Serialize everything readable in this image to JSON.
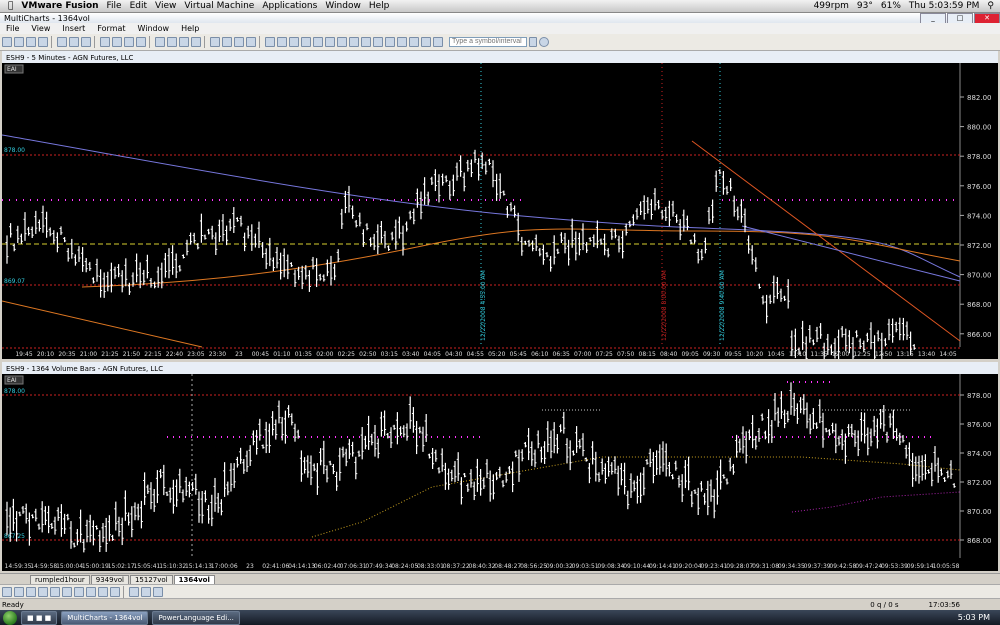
{
  "macmenu": {
    "app": "VMware Fusion",
    "items": [
      "File",
      "Edit",
      "View",
      "Virtual Machine",
      "Applications",
      "Window",
      "Help"
    ],
    "rpm": "499rpm",
    "temp": "93°",
    "battery": "61%",
    "clock": "Thu 5:03:59 PM"
  },
  "window": {
    "title": "MultiCharts - 1364vol"
  },
  "menu": [
    "File",
    "View",
    "Insert",
    "Format",
    "Window",
    "Help"
  ],
  "toolbar": {
    "symbol_placeholder": "Type a symbol/interval"
  },
  "chart1": {
    "header": "ESH9 - 5 Minutes - AGN Futures, LLC",
    "badge": "EAI",
    "level_labels": [
      "878.00",
      "869.07"
    ],
    "price_axis": [
      "882.00",
      "880.00",
      "878.00",
      "876.00",
      "874.00",
      "872.00",
      "870.00",
      "868.00",
      "866.00"
    ],
    "time_axis": [
      "19:45",
      "20:10",
      "20:35",
      "21:00",
      "21:25",
      "21:50",
      "22:15",
      "22:40",
      "23:05",
      "23:30",
      "23",
      "00:45",
      "01:10",
      "01:35",
      "02:00",
      "02:25",
      "02:50",
      "03:15",
      "03:40",
      "04:05",
      "04:30",
      "04:55",
      "05:20",
      "05:45",
      "06:10",
      "06:35",
      "07:00",
      "07:25",
      "07:50",
      "08:15",
      "08:40",
      "09:05",
      "09:30",
      "09:55",
      "10:20",
      "10:45",
      "11:10",
      "11:35",
      "12:00",
      "12:25",
      "12:50",
      "13:15",
      "13:40",
      "14:05"
    ],
    "vline_labels": [
      "12/22/2008 4:55:00 AM",
      "12/22/2008 8:00:00 AM",
      "12/22/2008 9:40:00 AM"
    ]
  },
  "chart2": {
    "header": "ESH9 - 1364 Volume Bars - AGN Futures, LLC",
    "badge": "EAI",
    "level_labels": [
      "878.00",
      "867.25"
    ],
    "price_axis": [
      "878.00",
      "876.00",
      "874.00",
      "872.00",
      "870.00",
      "868.00"
    ],
    "time_axis": [
      "14:59:35",
      "14:59:58",
      "15:00:04",
      "15:00:19",
      "15:02:17",
      "15:05:41",
      "15:10:32",
      "15:14:13",
      "17:00:06",
      "23",
      "02:41:06",
      "04:14:13",
      "06:02:40",
      "07:06:31",
      "07:49:34",
      "08:24:05",
      "08:33:01",
      "08:37:22",
      "08:40:32",
      "08:48:27",
      "08:56:25",
      "09:00:32",
      "09:03:51",
      "09:08:34",
      "09:10:44",
      "09:14:41",
      "09:20:04",
      "09:23:41",
      "09:28:07",
      "09:31:08",
      "09:34:35",
      "09:37:39",
      "09:42:58",
      "09:47:24",
      "09:53:39",
      "09:59:14",
      "10:05:58"
    ]
  },
  "tabs": [
    "rumpled1hour",
    "9349vol",
    "15127vol",
    "1364vol"
  ],
  "status": {
    "left": "Ready",
    "ratio": "0 q / 0 s",
    "time": "17:03:56"
  },
  "taskbar": {
    "tasks": [
      "MultiCharts - 1364vol",
      "PowerLanguage Edi..."
    ],
    "clock": "5:03 PM"
  },
  "colors": {
    "chart_bg": "#000000",
    "bars": "#ffffff",
    "level": "#cc2222",
    "magenta": "#ff33ff",
    "accent_cyan": "#33ccdd"
  }
}
